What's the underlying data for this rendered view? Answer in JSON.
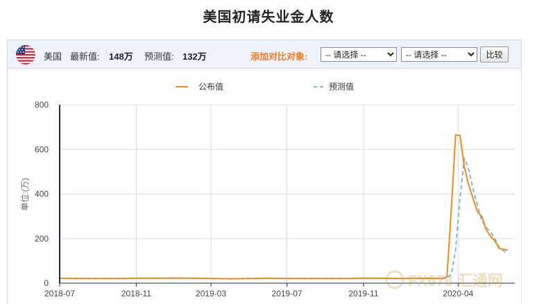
{
  "page": {
    "title": "美国初请失业金人数"
  },
  "toolbar": {
    "country": "美国",
    "latest_label": "最新值:",
    "latest_value": "148万",
    "forecast_label": "预测值:",
    "forecast_value": "132万",
    "compare_label": "添加对比对象:",
    "select1_value": "-- 请选择 --",
    "select2_value": "-- 请选择 --",
    "compare_button": "比较"
  },
  "watermark": {
    "text": "FX678 汇通网"
  },
  "colors": {
    "published": "#f08a1c",
    "forecast": "#7fb2e5",
    "axis": "#1b2a4a",
    "grid": "#dddddd",
    "accent": "#f07c1f"
  },
  "chart_data": {
    "type": "line",
    "title": "",
    "xlabel": "",
    "ylabel": "单位:(万)",
    "ylim": [
      0,
      800
    ],
    "yticks": [
      0,
      200,
      400,
      600,
      800
    ],
    "xlim": [
      "2018-07-01",
      "2020-07-01"
    ],
    "xticks": [
      {
        "date": "2018-07-01",
        "label": "2018-07"
      },
      {
        "date": "2018-11-01",
        "label": "2018-11"
      },
      {
        "date": "2019-03-01",
        "label": "2019-03"
      },
      {
        "date": "2019-07-01",
        "label": "2019-07"
      },
      {
        "date": "2019-11-01",
        "label": "2019-11"
      },
      {
        "date": "2020-04-01",
        "label": "2020-04"
      }
    ],
    "grid": true,
    "legend_position": "top",
    "series": [
      {
        "name": "公布值",
        "style": "solid",
        "points": [
          [
            "2018-07-01",
            22
          ],
          [
            "2018-08-01",
            21
          ],
          [
            "2018-09-01",
            21
          ],
          [
            "2018-10-01",
            21
          ],
          [
            "2018-11-01",
            22
          ],
          [
            "2018-12-01",
            22
          ],
          [
            "2019-01-01",
            23
          ],
          [
            "2019-02-01",
            22
          ],
          [
            "2019-03-01",
            21
          ],
          [
            "2019-04-01",
            20
          ],
          [
            "2019-05-01",
            21
          ],
          [
            "2019-06-01",
            22
          ],
          [
            "2019-07-01",
            21
          ],
          [
            "2019-08-01",
            21
          ],
          [
            "2019-09-01",
            21
          ],
          [
            "2019-10-01",
            21
          ],
          [
            "2019-11-01",
            22
          ],
          [
            "2019-12-01",
            22
          ],
          [
            "2020-01-01",
            21
          ],
          [
            "2020-02-01",
            22
          ],
          [
            "2020-03-07",
            21
          ],
          [
            "2020-03-14",
            28
          ],
          [
            "2020-03-21",
            330
          ],
          [
            "2020-03-28",
            665
          ],
          [
            "2020-04-04",
            662
          ],
          [
            "2020-04-11",
            520
          ],
          [
            "2020-04-18",
            440
          ],
          [
            "2020-04-25",
            380
          ],
          [
            "2020-05-02",
            320
          ],
          [
            "2020-05-09",
            300
          ],
          [
            "2020-05-16",
            240
          ],
          [
            "2020-05-23",
            210
          ],
          [
            "2020-05-30",
            190
          ],
          [
            "2020-06-06",
            155
          ],
          [
            "2020-06-13",
            152
          ],
          [
            "2020-06-20",
            148
          ]
        ]
      },
      {
        "name": "预测值",
        "style": "dashed",
        "points": [
          [
            "2018-07-01",
            22
          ],
          [
            "2018-08-01",
            21
          ],
          [
            "2018-09-01",
            21
          ],
          [
            "2018-10-01",
            21
          ],
          [
            "2018-11-01",
            22
          ],
          [
            "2018-12-01",
            22
          ],
          [
            "2019-01-01",
            22
          ],
          [
            "2019-02-01",
            22
          ],
          [
            "2019-03-01",
            21
          ],
          [
            "2019-04-01",
            20
          ],
          [
            "2019-05-01",
            21
          ],
          [
            "2019-06-01",
            22
          ],
          [
            "2019-07-01",
            21
          ],
          [
            "2019-08-01",
            21
          ],
          [
            "2019-09-01",
            21
          ],
          [
            "2019-10-01",
            21
          ],
          [
            "2019-11-01",
            22
          ],
          [
            "2019-12-01",
            22
          ],
          [
            "2020-01-01",
            21
          ],
          [
            "2020-02-01",
            22
          ],
          [
            "2020-03-07",
            21
          ],
          [
            "2020-03-14",
            22
          ],
          [
            "2020-03-21",
            40
          ],
          [
            "2020-03-28",
            150
          ],
          [
            "2020-04-04",
            380
          ],
          [
            "2020-04-11",
            560
          ],
          [
            "2020-04-18",
            510
          ],
          [
            "2020-04-25",
            420
          ],
          [
            "2020-05-02",
            350
          ],
          [
            "2020-05-09",
            280
          ],
          [
            "2020-05-16",
            250
          ],
          [
            "2020-05-23",
            230
          ],
          [
            "2020-05-30",
            200
          ],
          [
            "2020-06-06",
            160
          ],
          [
            "2020-06-13",
            145
          ],
          [
            "2020-06-20",
            132
          ]
        ]
      }
    ]
  }
}
